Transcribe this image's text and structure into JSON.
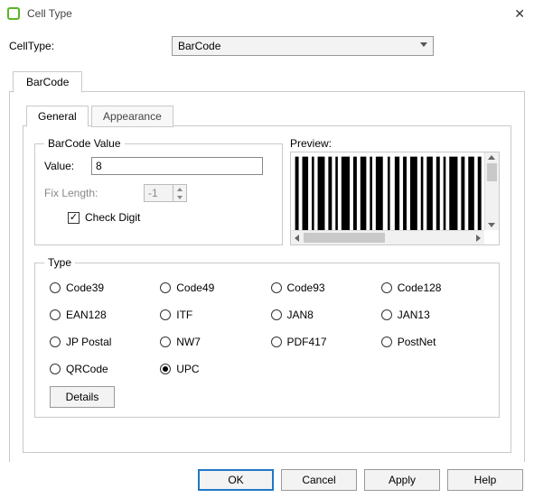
{
  "window": {
    "title": "Cell Type",
    "close_glyph": "✕"
  },
  "celltype_row": {
    "label": "CellType:",
    "selected": "BarCode"
  },
  "outer_tab": {
    "label": "BarCode"
  },
  "inner_tabs": {
    "general": "General",
    "appearance": "Appearance"
  },
  "value_group": {
    "legend": "BarCode Value",
    "value_label": "Value:",
    "value": "8",
    "fixlen_label": "Fix Length:",
    "fixlen_value": "-1",
    "checkdigit_label": "Check Digit"
  },
  "preview": {
    "label": "Preview:"
  },
  "type_group": {
    "legend": "Type",
    "options": [
      "Code39",
      "Code49",
      "Code93",
      "Code128",
      "EAN128",
      "ITF",
      "JAN8",
      "JAN13",
      "JP Postal",
      "NW7",
      "PDF417",
      "PostNet",
      "QRCode",
      "UPC"
    ],
    "selected": "UPC",
    "details_label": "Details"
  },
  "actions": {
    "ok": "OK",
    "cancel": "Cancel",
    "apply": "Apply",
    "help": "Help"
  }
}
